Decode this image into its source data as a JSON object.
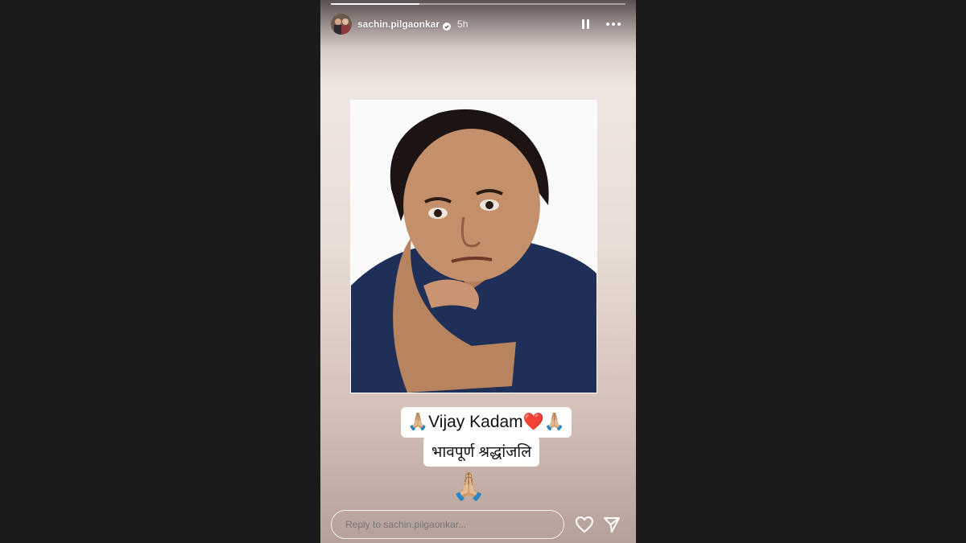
{
  "story": {
    "username": "sachin.pilgaonkar",
    "time_ago": "5h",
    "progress": 0.3,
    "caption_line1_text": "Vijay Kadam",
    "caption_line1_prefix_emoji": "🙏🏼",
    "caption_line1_heart_emoji": "❤️",
    "caption_line1_suffix_emoji": "🙏🏼",
    "caption_line2": "भावपूर्ण श्रद्धांजलि",
    "sticker_emoji": "🙏🏼"
  },
  "reply": {
    "placeholder": "Reply to sachin.pilgaonkar..."
  },
  "icons": {
    "verified": "verified-badge-icon",
    "pause": "pause-icon",
    "more": "more-options-icon",
    "like": "heart-icon",
    "share": "send-icon"
  },
  "colors": {
    "page_background": "#1b1b1b",
    "white": "#ffffff"
  }
}
